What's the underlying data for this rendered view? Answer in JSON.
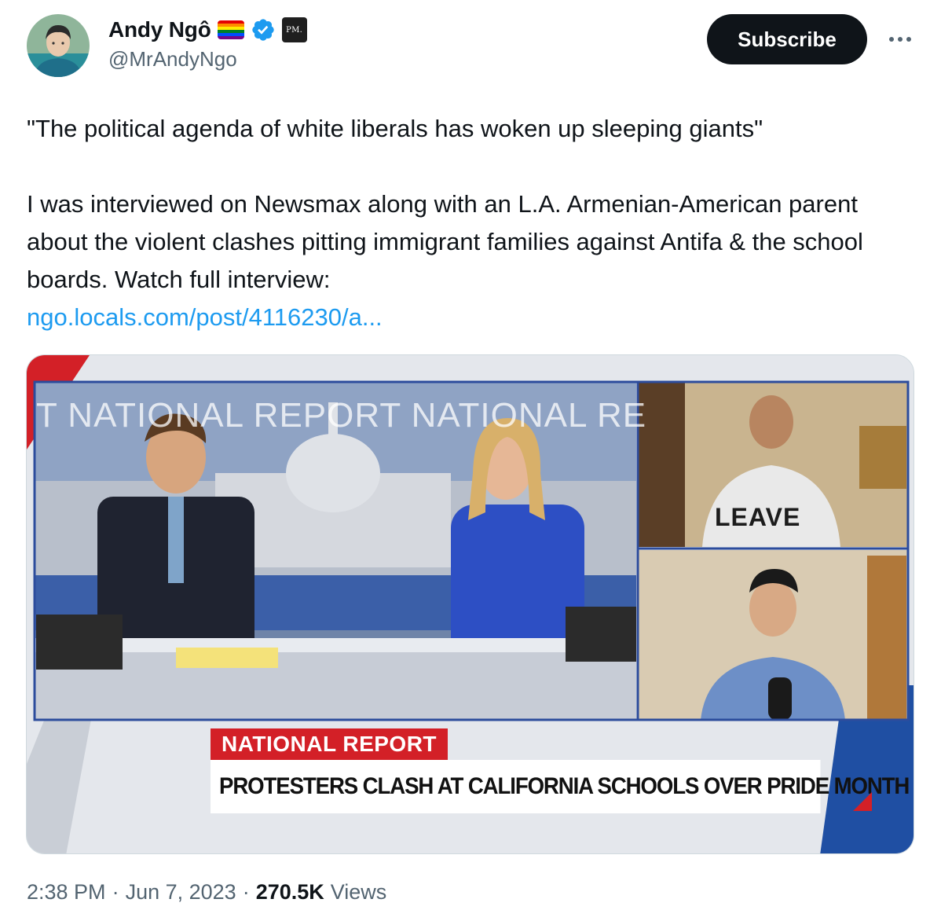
{
  "author": {
    "display_name": "Andy Ngô",
    "handle": "@MrAndyNgo",
    "avatar_icon": "avatar-icon",
    "badges": [
      "rainbow-flag-icon",
      "verified-check-icon",
      "pm-badge"
    ],
    "pm_badge_text": "PM.",
    "verified_color": "#1d9bf0"
  },
  "actions": {
    "subscribe_label": "Subscribe",
    "more_icon": "more-horizontal-icon"
  },
  "tweet": {
    "quote": "\"The political agenda of white liberals has woken up sleeping giants\"",
    "body": "I was interviewed on Newsmax along with an L.A. Armenian-American parent about the violent clashes pitting immigrant families against Antifa & the school boards. Watch full interview:",
    "link_text": "ngo.locals.com/post/4116230/a..."
  },
  "media": {
    "studio_backdrop_text": "T NATIONAL REPORT NATIONAL RE",
    "shirt_text": "LEAVE",
    "lower_third_label": "NATIONAL REPORT",
    "lower_third_headline": "PROTESTERS CLASH AT CALIFORNIA SCHOOLS OVER PRIDE MONTH"
  },
  "footer": {
    "time": "2:38 PM",
    "separator": "·",
    "date": "Jun 7, 2023",
    "views_count": "270.5K",
    "views_label": "Views"
  },
  "colors": {
    "text_primary": "#0f1419",
    "text_secondary": "#536471",
    "link": "#1d9bf0",
    "button_bg": "#0f1419",
    "newsmax_red": "#d32027",
    "newsmax_blue": "#1f4fa3"
  }
}
